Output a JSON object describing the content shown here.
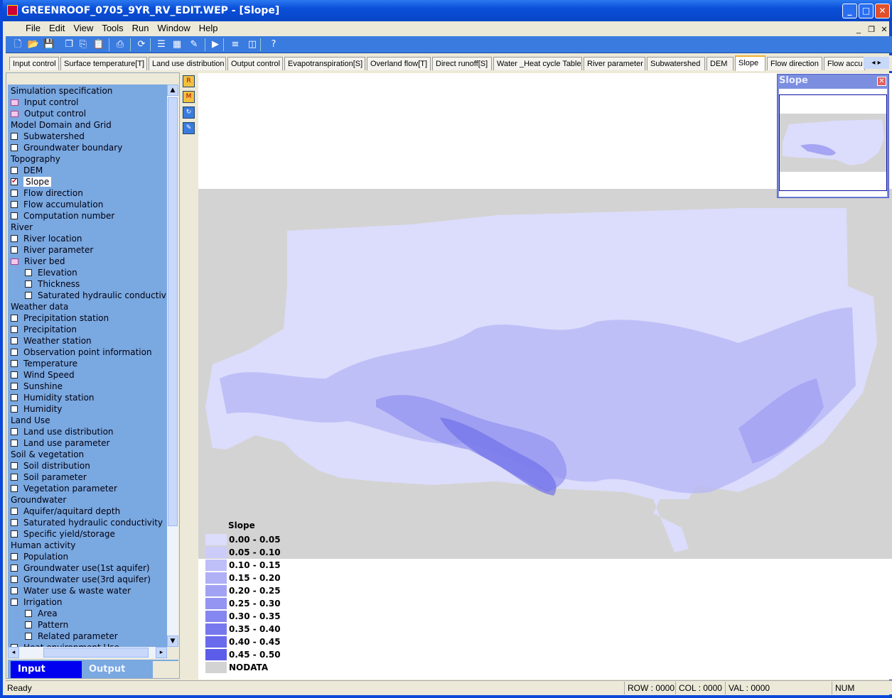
{
  "window": {
    "title": "GREENROOF_0705_9YR_RV_EDIT.WEP - [Slope]",
    "controls": [
      "minimize",
      "maximize",
      "close"
    ]
  },
  "menu": [
    "File",
    "Edit",
    "View",
    "Tools",
    "Run",
    "Window",
    "Help"
  ],
  "toolbar_icons": [
    "new-icon",
    "open-icon",
    "save-icon",
    "save-all-icon",
    "copy-icon",
    "paste-icon",
    "print-icon",
    "refresh-icon",
    "report-icon",
    "chart-icon",
    "pencil-icon",
    "run-icon",
    "table-icon",
    "columns-icon",
    "help-icon"
  ],
  "tabs": [
    "Input control",
    "Surface temperature[T]",
    "Land use distribution",
    "Output control",
    "Evapotranspiration[S]",
    "Overland flow[T]",
    "Direct runoff[S]",
    "Water _Heat cycle Table",
    "River parameter",
    "Subwatershed",
    "DEM",
    "Slope",
    "Flow direction",
    "Flow accu"
  ],
  "active_tab": "Slope",
  "tree": [
    {
      "label": "Simulation specification",
      "type": "header"
    },
    {
      "label": "Input control",
      "type": "folder"
    },
    {
      "label": "Output control",
      "type": "folder"
    },
    {
      "label": "Model Domain and Grid",
      "type": "header"
    },
    {
      "label": "Subwatershed",
      "type": "check"
    },
    {
      "label": "Groundwater boundary",
      "type": "check"
    },
    {
      "label": "Topography",
      "type": "header"
    },
    {
      "label": "DEM",
      "type": "check"
    },
    {
      "label": "Slope",
      "type": "checked"
    },
    {
      "label": "Flow direction",
      "type": "check"
    },
    {
      "label": "Flow accumulation",
      "type": "check"
    },
    {
      "label": "Computation number",
      "type": "check"
    },
    {
      "label": "River",
      "type": "header"
    },
    {
      "label": "River location",
      "type": "check"
    },
    {
      "label": "River parameter",
      "type": "check"
    },
    {
      "label": "River bed",
      "type": "folder"
    },
    {
      "label": "Elevation",
      "type": "subcheck"
    },
    {
      "label": "Thickness",
      "type": "subcheck"
    },
    {
      "label": "Saturated hydraulic conductivity",
      "type": "subcheck"
    },
    {
      "label": "Weather data",
      "type": "header"
    },
    {
      "label": "Precipitation station",
      "type": "check"
    },
    {
      "label": "Precipitation",
      "type": "check"
    },
    {
      "label": "Weather station",
      "type": "check"
    },
    {
      "label": "Observation point information",
      "type": "check"
    },
    {
      "label": "Temperature",
      "type": "check"
    },
    {
      "label": "Wind Speed",
      "type": "check"
    },
    {
      "label": "Sunshine",
      "type": "check"
    },
    {
      "label": "Humidity station",
      "type": "check"
    },
    {
      "label": "Humidity",
      "type": "check"
    },
    {
      "label": "Land Use",
      "type": "header"
    },
    {
      "label": "Land use distribution",
      "type": "check"
    },
    {
      "label": "Land use parameter",
      "type": "check"
    },
    {
      "label": "Soil & vegetation",
      "type": "header"
    },
    {
      "label": "Soil distribution",
      "type": "check"
    },
    {
      "label": "Soil parameter",
      "type": "check"
    },
    {
      "label": "Vegetation parameter",
      "type": "check"
    },
    {
      "label": "Groundwater",
      "type": "header"
    },
    {
      "label": "Aquifer/aquitard depth",
      "type": "check"
    },
    {
      "label": "Saturated hydraulic conductivity",
      "type": "check"
    },
    {
      "label": "Specific yield/storage",
      "type": "check"
    },
    {
      "label": "Human activity",
      "type": "header"
    },
    {
      "label": "Population",
      "type": "check"
    },
    {
      "label": "Groundwater use(1st aquifer)",
      "type": "check"
    },
    {
      "label": "Groundwater use(3rd aquifer)",
      "type": "check"
    },
    {
      "label": "Water use & waste water",
      "type": "check"
    },
    {
      "label": "Irrigation",
      "type": "check"
    },
    {
      "label": "Area",
      "type": "subcheck"
    },
    {
      "label": "Pattern",
      "type": "subcheck"
    },
    {
      "label": "Related parameter",
      "type": "subcheck"
    },
    {
      "label": "Heat environment Use",
      "type": "check"
    }
  ],
  "bottom_tabs": {
    "input": "Input",
    "output": "Output",
    "active": "Input"
  },
  "legend": {
    "title": "Slope",
    "items": [
      {
        "label": "0.00 - 0.05",
        "color": "#dcdcfc"
      },
      {
        "label": "0.05 - 0.10",
        "color": "#ccccfa"
      },
      {
        "label": "0.10 - 0.15",
        "color": "#bebef8"
      },
      {
        "label": "0.15 - 0.20",
        "color": "#b0b0f6"
      },
      {
        "label": "0.20 - 0.25",
        "color": "#a2a2f4"
      },
      {
        "label": "0.25 - 0.30",
        "color": "#9494f2"
      },
      {
        "label": "0.30 - 0.35",
        "color": "#8686f0"
      },
      {
        "label": "0.35 - 0.40",
        "color": "#7878ee"
      },
      {
        "label": "0.40 - 0.45",
        "color": "#6a6aec"
      },
      {
        "label": "0.45 - 0.50",
        "color": "#5c5cea"
      },
      {
        "label": "NODATA",
        "color": "#d3d3d3"
      }
    ]
  },
  "overview": {
    "title": "Slope"
  },
  "status": {
    "text": "Ready",
    "row": "ROW : 0000",
    "col": "COL : 0000",
    "val": "VAL : 0000",
    "num": "NUM"
  }
}
